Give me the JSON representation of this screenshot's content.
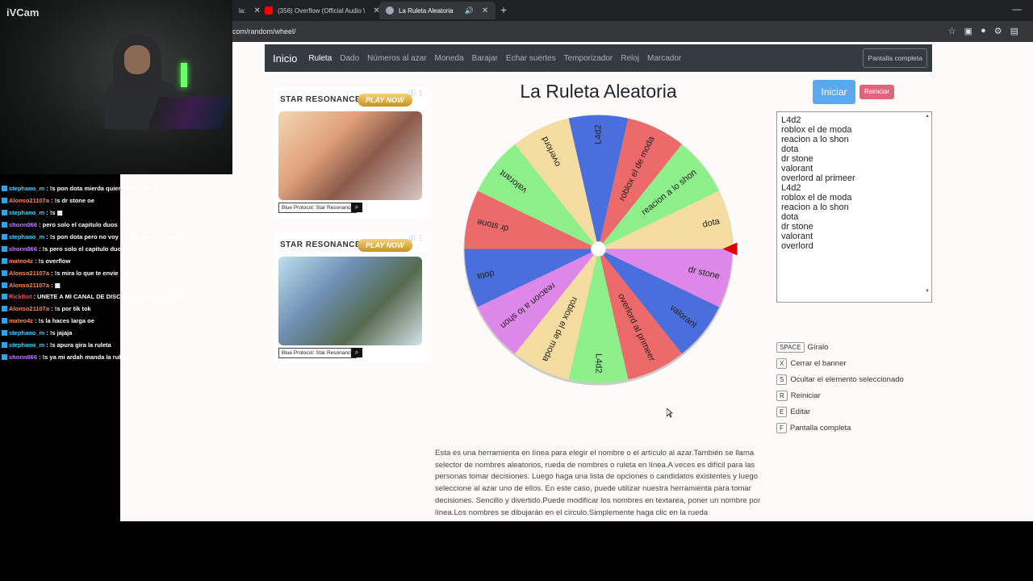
{
  "browser": {
    "tabs": [
      {
        "label": "la:"
      },
      {
        "label": "(356) Overflow (Official Audio \\",
        "color": "#ff0000"
      },
      {
        "label": "La Ruleta Aleatoria",
        "color": "#9ab"
      }
    ],
    "url": "com/random/wheel/"
  },
  "webcam": {
    "label": "iVCam"
  },
  "navbar": {
    "brand": "Inicio",
    "links": [
      "Ruleta",
      "Dado",
      "Números al azar",
      "Moneda",
      "Barajar",
      "Echar suertes",
      "Temporizador",
      "Reloj",
      "Marcador"
    ],
    "active": "Ruleta",
    "fullscreen": "Pantalla completa"
  },
  "ads": [
    {
      "logo": "STAR RESONANCE",
      "play": "PLAY NOW",
      "cta": "Blue Protocol: Star Resonance"
    },
    {
      "logo": "STAR RESONANCE",
      "play": "PLAY NOW",
      "cta": "Blue Protocol: Star Resonance"
    }
  ],
  "page": {
    "title": "La Ruleta Aleatoria"
  },
  "controls": {
    "start": "Iniciar",
    "reset": "Reiniciar"
  },
  "names": [
    "L4d2",
    "roblox el de moda",
    "reacion a lo shon",
    "dota",
    "dr stone",
    "valorant",
    "overlord al primeer",
    "L4d2",
    "roblox el de moda",
    "reacion a lo shon",
    "dota",
    "dr stone",
    "valorant",
    "overlord"
  ],
  "wheel": {
    "segments": [
      {
        "label": "L4d2",
        "color": "#4a6fdc"
      },
      {
        "label": "roblox el de moda",
        "color": "#ec6a6a"
      },
      {
        "label": "reacion a lo shon",
        "color": "#8ef08a"
      },
      {
        "label": "dota",
        "color": "#f5dca0"
      },
      {
        "label": "dr stone",
        "color": "#dd88e8"
      },
      {
        "label": "valorant",
        "color": "#4a6fdc"
      },
      {
        "label": "overlord al primeer",
        "color": "#ec6a6a"
      },
      {
        "label": "L4d2",
        "color": "#8ef08a"
      },
      {
        "label": "roblox el de moda",
        "color": "#f5dca0"
      },
      {
        "label": "reacion a lo shon",
        "color": "#dd88e8"
      },
      {
        "label": "dota",
        "color": "#4a6fdc"
      },
      {
        "label": "dr stone",
        "color": "#ec6a6a"
      },
      {
        "label": "valorant",
        "color": "#8ef08a"
      },
      {
        "label": "overlord",
        "color": "#f5dca0"
      }
    ],
    "pointer_color": "#e00000"
  },
  "shortcuts": [
    {
      "key": "SPACE",
      "label": "Gíralo"
    },
    {
      "key": "X",
      "label": "Cerrar el banner"
    },
    {
      "key": "S",
      "label": "Ocultar el elemento seleccionado"
    },
    {
      "key": "R",
      "label": "Reiniciar"
    },
    {
      "key": "E",
      "label": "Editar"
    },
    {
      "key": "F",
      "label": "Pantalla completa"
    }
  ],
  "description": "Esta es una herramienta en línea para elegir el nombre o el artículo al azar.También se llama selector de nombres aleatorios, rueda de nombres o ruleta en línea.A veces es difícil para las personas tomar decisiones. Luego haga una lista de opciones o candidatos existentes y luego seleccione al azar uno de ellos. En este caso, puede utilizar nuestra herramienta para tomar decisiones. Sencillo y divertido.Puede modificar los nombres en textarea, poner un nombre por línea.Los nombres se dibujarán en el círculo.Simplemente haga clic en la rueda",
  "chat": [
    {
      "user": "stephano_m",
      "color": "blue",
      "msg": " : !s pon dota mierda quiero verte llorar"
    },
    {
      "user": "Alonso21107a",
      "color": "orange",
      "msg": " : !s dr stone oe"
    },
    {
      "user": "stephano_m",
      "color": "blue",
      "msg": " : !s ▩"
    },
    {
      "user": "shonn066",
      "color": "purple",
      "msg": " : pero solo el capitulo duos"
    },
    {
      "user": "stephano_m",
      "color": "blue",
      "msg": " : !s pon dota pero no voy a jugar overlige noooo"
    },
    {
      "user": "shonn066",
      "color": "purple",
      "msg": " : !s pero solo el capitulo duos"
    },
    {
      "user": "mateo4z",
      "color": "orange",
      "msg": " : !s overflow"
    },
    {
      "user": "Alonso21107a",
      "color": "orange",
      "msg": " : !s mira lo que te envie pee"
    },
    {
      "user": "Alonso21107a",
      "color": "orange",
      "msg": " : ▩"
    },
    {
      "user": "RickBot",
      "color": "red",
      "msg": " : UNETE A MI CANAL DE DISCORD https://discord.gg/"
    },
    {
      "user": "Alonso21107a",
      "color": "orange",
      "msg": " : !s por tik tok"
    },
    {
      "user": "mateo4z",
      "color": "orange",
      "msg": " : !s la haces larga oe"
    },
    {
      "user": "stephano_m",
      "color": "blue",
      "msg": " : !s jajaja"
    },
    {
      "user": "stephano_m",
      "color": "blue",
      "msg": " : !s apura gira la ruleta"
    },
    {
      "user": "shonn066",
      "color": "purple",
      "msg": " : !s ya mi ardah manda la ruleta"
    }
  ]
}
